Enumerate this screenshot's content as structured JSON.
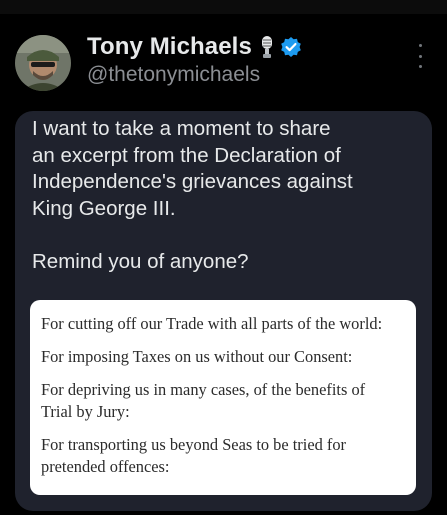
{
  "author": {
    "display_name": "Tony Michaels",
    "handle": "@thetonymichaels",
    "badge_icon": "microphone-icon",
    "verified_icon": "verified-badge-icon",
    "verified_color": "#1d9bf0"
  },
  "menu": {
    "icon": "more-vertical-icon"
  },
  "post": {
    "text": "I want to take a moment to share\nan excerpt from the Declaration of\nIndependence's grievances against\nKing George III.\n\nRemind you of anyone?"
  },
  "excerpt": {
    "grievances": [
      {
        "line1": "For cutting off our Trade with all parts of the world:",
        "line2": ""
      },
      {
        "line1": "For imposing Taxes on us without our Consent:",
        "line2": ""
      },
      {
        "line1": "For depriving us in many cases, of the benefits of",
        "line2": "Trial by Jury:"
      },
      {
        "line1": "For transporting us beyond Seas to be tried for",
        "line2": "pretended offences:"
      }
    ]
  },
  "colors": {
    "background": "#000000",
    "bubble": "#1f222d",
    "text_primary": "#e7e9ea",
    "text_secondary": "#8b8e93",
    "card_background": "#ffffff"
  }
}
